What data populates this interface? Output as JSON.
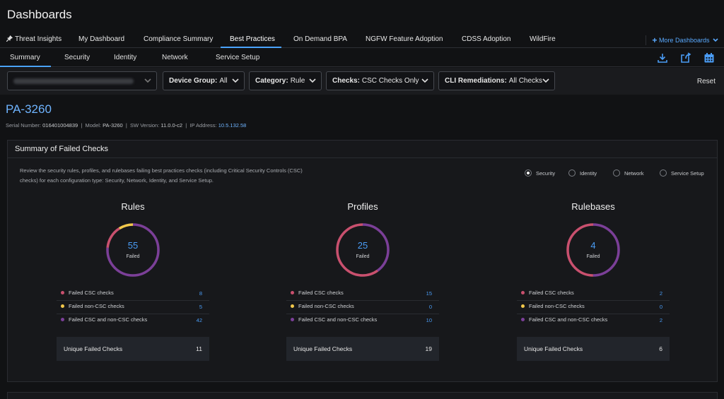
{
  "app": {
    "title": "Dashboards"
  },
  "nav_tabs": [
    {
      "label": "Threat Insights",
      "icon": "pin-icon"
    },
    {
      "label": "My Dashboard"
    },
    {
      "label": "Compliance Summary"
    },
    {
      "label": "Best Practices",
      "active": true
    },
    {
      "label": "On Demand BPA"
    },
    {
      "label": "NGFW Feature Adoption"
    },
    {
      "label": "CDSS Adoption"
    },
    {
      "label": "WildFire"
    }
  ],
  "more_dashboards": "More Dashboards",
  "sub_tabs": [
    {
      "label": "Summary",
      "active": true
    },
    {
      "label": "Security"
    },
    {
      "label": "Identity"
    },
    {
      "label": "Network"
    },
    {
      "label": "Service Setup"
    }
  ],
  "toolbar_icons": [
    "download-icon",
    "share-icon",
    "calendar-icon"
  ],
  "filters": {
    "device": {
      "value": "Device: [redacted]",
      "blurred": true
    },
    "device_group": {
      "label": "Device Group:",
      "value": "All"
    },
    "category": {
      "label": "Category:",
      "value": "Rule"
    },
    "checks": {
      "label": "Checks:",
      "value": "CSC Checks Only"
    },
    "cli_remediations": {
      "label": "CLI Remediations:",
      "value": "All Checks"
    },
    "reset": "Reset"
  },
  "device": {
    "name": "PA-3260",
    "serial_label": "Serial Number:",
    "serial": "016401004839",
    "model_label": "Model:",
    "model": "PA-3260",
    "sw_label": "SW Version:",
    "sw": "11.0.0-c2",
    "ip_label": "IP Address:",
    "ip": "10.5.132.58"
  },
  "summary": {
    "title": "Summary of Failed Checks",
    "description": "Review the security rules, profiles, and rulebases failing best practices checks (including Critical Security Controls (CSC) checks) for each configuration type: Security, Network, Identity, and Service Setup.",
    "radios": [
      {
        "label": "Security",
        "selected": true
      },
      {
        "label": "Identity",
        "selected": false
      },
      {
        "label": "Network",
        "selected": false
      },
      {
        "label": "Service Setup",
        "selected": false
      }
    ],
    "colors": {
      "csc": "#c9506e",
      "non_csc": "#f2c84b",
      "both": "#7b3f98"
    },
    "failed_label": "Failed",
    "unique_label": "Unique Failed Checks",
    "legend_labels": [
      "Failed CSC checks",
      "Failed non-CSC checks",
      "Failed CSC and non-CSC checks"
    ],
    "columns": [
      {
        "title": "Rules",
        "total": "55",
        "csc": 8,
        "non_csc": 5,
        "both": 42,
        "unique": "11"
      },
      {
        "title": "Profiles",
        "total": "25",
        "csc": 15,
        "non_csc": 0,
        "both": 10,
        "unique": "19"
      },
      {
        "title": "Rulebases",
        "total": "4",
        "csc": 2,
        "non_csc": 0,
        "both": 2,
        "unique": "6"
      }
    ]
  }
}
